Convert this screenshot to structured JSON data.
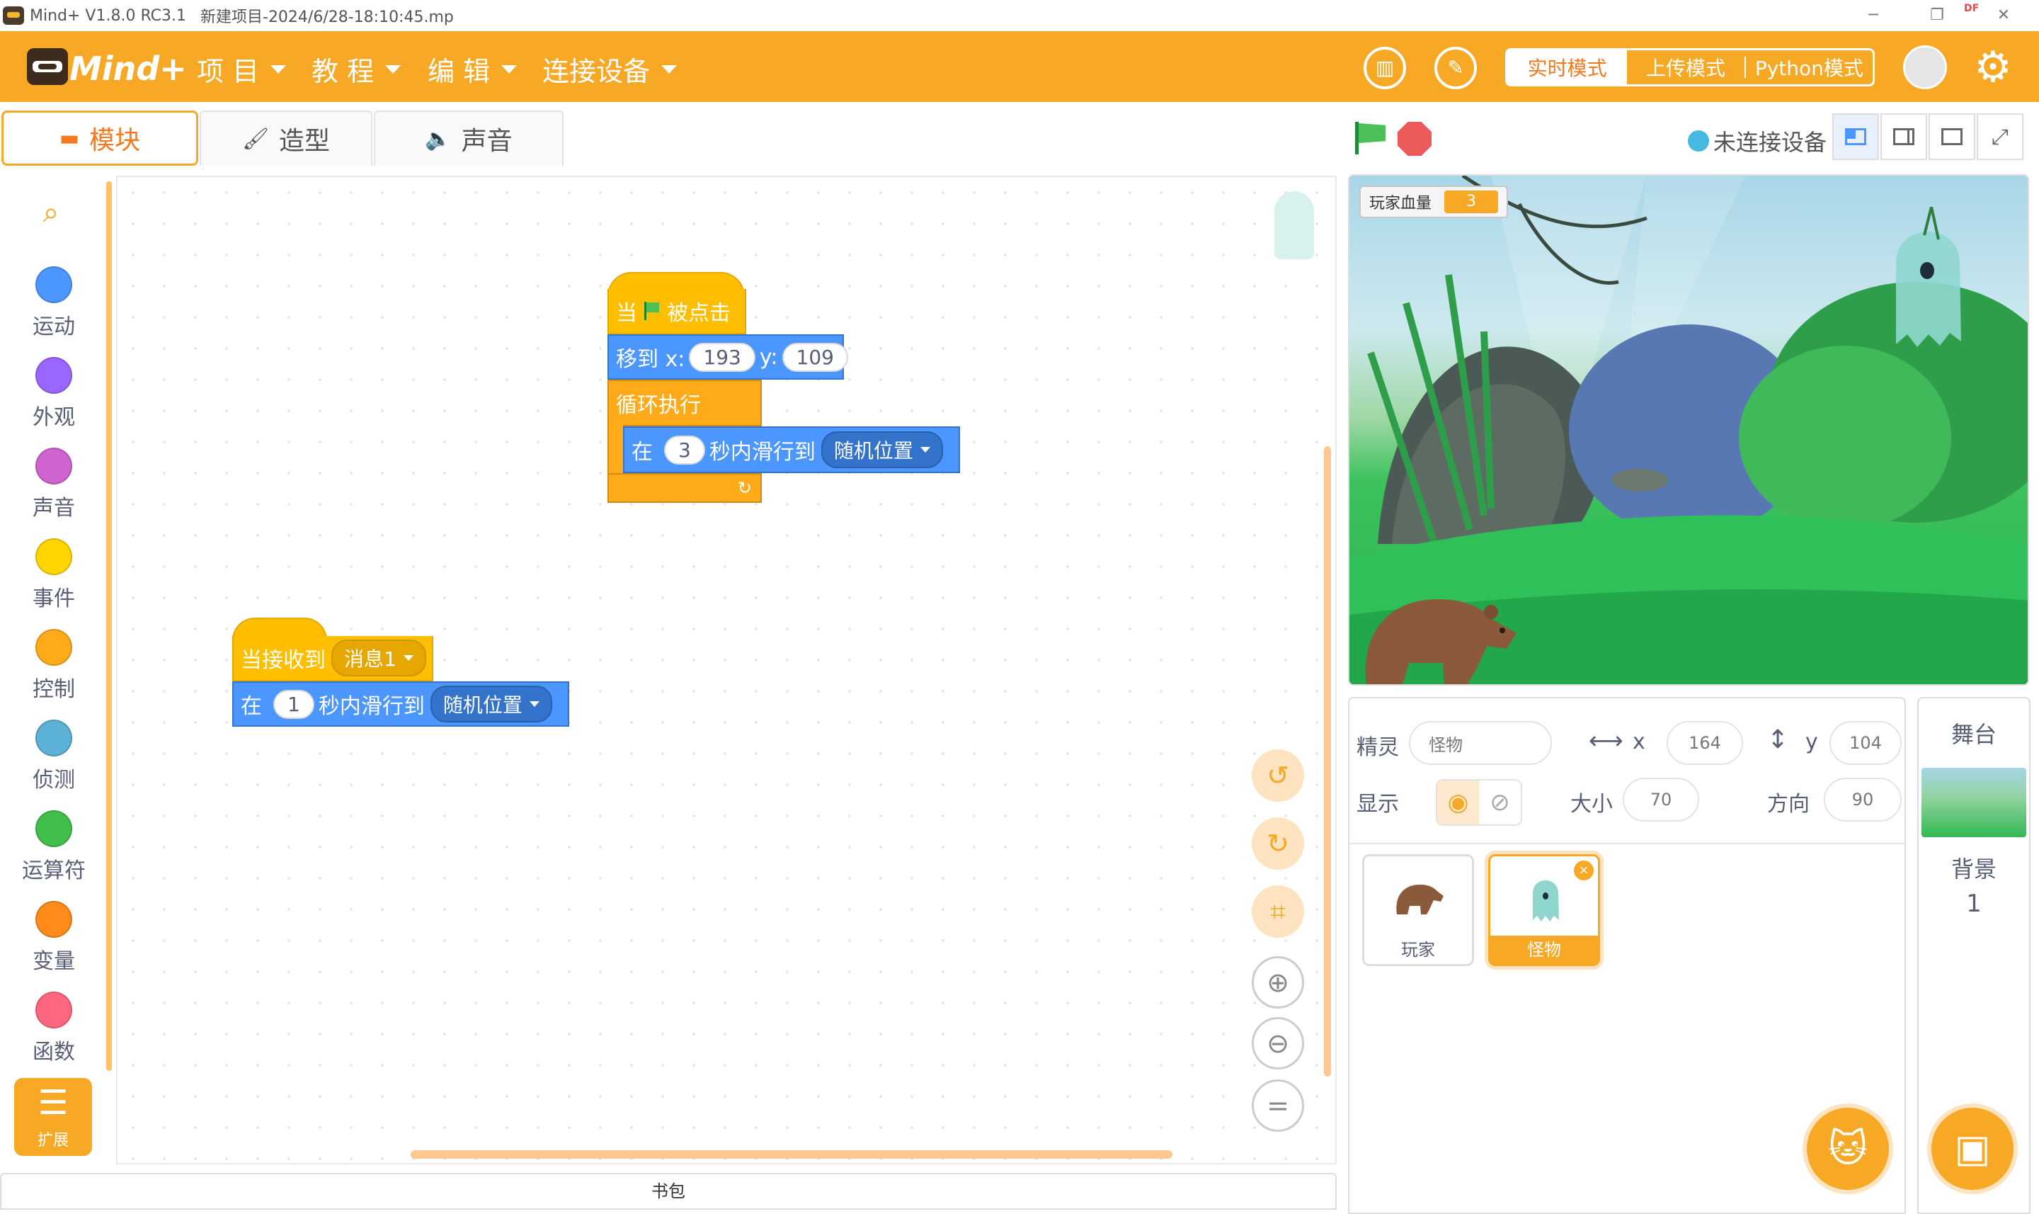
{
  "titlebar": {
    "app_title": "Mind+ V1.8.0 RC3.1",
    "file_name": "新建项目-2024/6/28-18:10:45.mp",
    "badge": "DF"
  },
  "menubar": {
    "logo_text": "Mind+",
    "menus": [
      "项 目",
      "教 程",
      "编 辑",
      "连接设备"
    ],
    "modes": [
      "实时模式",
      "上传模式",
      "Python模式"
    ],
    "active_mode": "实时模式"
  },
  "editor_tabs": [
    {
      "label": "模块",
      "icon": "blocks-icon",
      "active": true
    },
    {
      "label": "造型",
      "icon": "brush-icon",
      "active": false
    },
    {
      "label": "声音",
      "icon": "speaker-icon",
      "active": false
    }
  ],
  "categories": [
    {
      "label": "运动",
      "color": "#4c97ff"
    },
    {
      "label": "外观",
      "color": "#9966ff"
    },
    {
      "label": "声音",
      "color": "#cf63cf"
    },
    {
      "label": "事件",
      "color": "#ffd500"
    },
    {
      "label": "控制",
      "color": "#ffab19"
    },
    {
      "label": "侦测",
      "color": "#5cb1d6"
    },
    {
      "label": "运算符",
      "color": "#40bf4a"
    },
    {
      "label": "变量",
      "color": "#ff8c1a"
    },
    {
      "label": "函数",
      "color": "#ff6680"
    }
  ],
  "extension_label": "扩展",
  "scripts": {
    "script1": {
      "hat_when": "当",
      "hat_clicked": "被点击",
      "goto_label": "移到 x:",
      "goto_x": "193",
      "goto_y_label": "y:",
      "goto_y": "109",
      "loop_label": "循环执行",
      "glide_in": "在",
      "glide_secs": "3",
      "glide_to": "秒内滑行到",
      "glide_target": "随机位置"
    },
    "script2": {
      "hat_receive": "当接收到",
      "message": "消息1",
      "glide_in": "在",
      "glide_secs": "1",
      "glide_to": "秒内滑行到",
      "glide_target": "随机位置"
    }
  },
  "workspace_tools": [
    "undo-icon",
    "redo-icon",
    "crop-icon",
    "zoom-in-icon",
    "zoom-out-icon",
    "zoom-reset-icon"
  ],
  "zoom_reset_glyph": "=",
  "backpack_label": "书包",
  "stage_header": {
    "device_status": "未连接设备"
  },
  "stage": {
    "monitor_label": "玩家血量",
    "monitor_value": "3"
  },
  "sprite_info": {
    "sprite_label": "精灵",
    "sprite_name": "怪物",
    "x_label": "x",
    "x_value": "164",
    "y_label": "y",
    "y_value": "104",
    "show_label": "显示",
    "size_label": "大小",
    "size_value": "70",
    "direction_label": "方向",
    "direction_value": "90"
  },
  "sprites": [
    {
      "name": "玩家",
      "selected": false
    },
    {
      "name": "怪物",
      "selected": true
    }
  ],
  "stage_panel": {
    "title": "舞台",
    "backdrop_label": "背景",
    "backdrop_count": "1"
  }
}
